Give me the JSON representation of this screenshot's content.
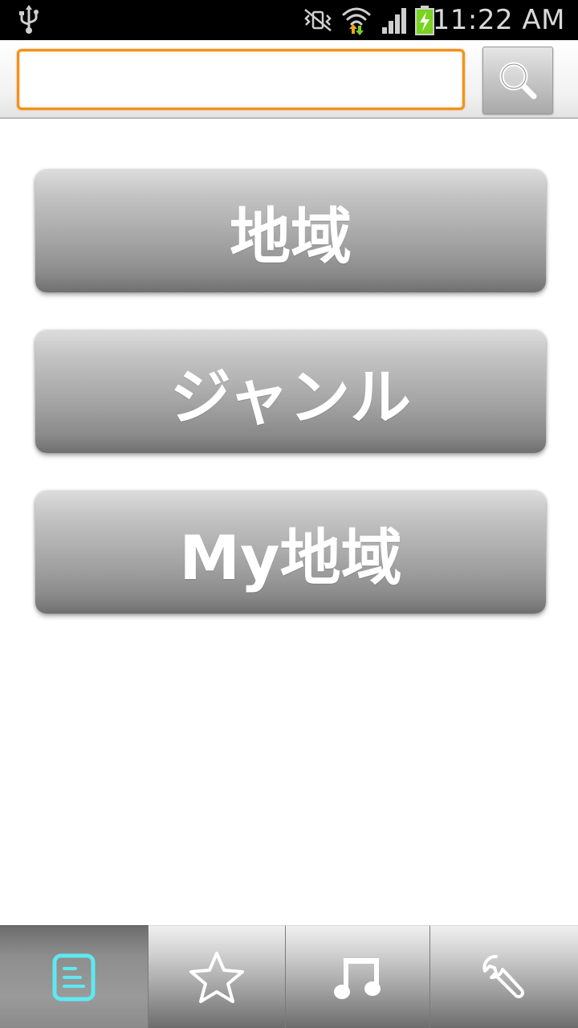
{
  "status_bar": {
    "time": "11:22 AM",
    "icons": [
      "usb-icon",
      "mute-vibrate-icon",
      "wifi-icon",
      "cell-signal-icon",
      "battery-charging-icon"
    ]
  },
  "search": {
    "value": "",
    "placeholder": "",
    "button_icon": "search-icon"
  },
  "menu": {
    "items": [
      {
        "label": "地域"
      },
      {
        "label": "ジャンル"
      },
      {
        "label": "My地域"
      }
    ]
  },
  "tabs": [
    {
      "icon": "list-icon",
      "active": true
    },
    {
      "icon": "star-icon",
      "active": false
    },
    {
      "icon": "music-note-icon",
      "active": false
    },
    {
      "icon": "wrench-icon",
      "active": false
    }
  ],
  "colors": {
    "accent_orange": "#f0921d",
    "active_tab_icon": "#5fe8f0",
    "status_bar_bg": "#000000",
    "battery_green": "#7ad321"
  }
}
